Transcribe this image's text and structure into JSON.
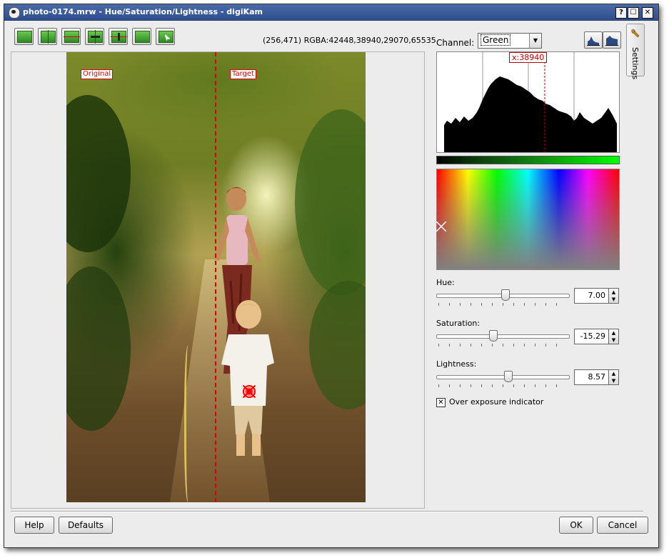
{
  "window": {
    "title": "photo-0174.mrw - Hue/Saturation/Lightness - digiKam",
    "help_btn": "?",
    "maximize_btn": "☐",
    "close_btn": "✕"
  },
  "toolbar": {
    "tools": [
      "original-image",
      "split-vertical",
      "split-horizontal",
      "split-vertical-duplicate",
      "split-horizontal-duplicate",
      "target-image",
      "under-mouse"
    ],
    "pixel_readout": "(256,471) RGBA:42448,38940,29070,65535"
  },
  "preview": {
    "original_label": "Original",
    "target_label": "Target"
  },
  "channel": {
    "label": "Channel:",
    "value": "Green"
  },
  "histogram": {
    "cursor_label": "x:38940",
    "channel_color": "#00ff00"
  },
  "sliders": {
    "hue": {
      "label": "Hue:",
      "value": "7.00",
      "position": 0.52
    },
    "saturation": {
      "label": "Saturation:",
      "value": "-15.29",
      "position": 0.43
    },
    "lightness": {
      "label": "Lightness:",
      "value": "8.57",
      "position": 0.54
    }
  },
  "overexposure": {
    "label": "Over exposure indicator",
    "checked": true
  },
  "side_tab": {
    "label": "Settings"
  },
  "buttons": {
    "help": "Help",
    "defaults": "Defaults",
    "ok": "OK",
    "cancel": "Cancel"
  }
}
